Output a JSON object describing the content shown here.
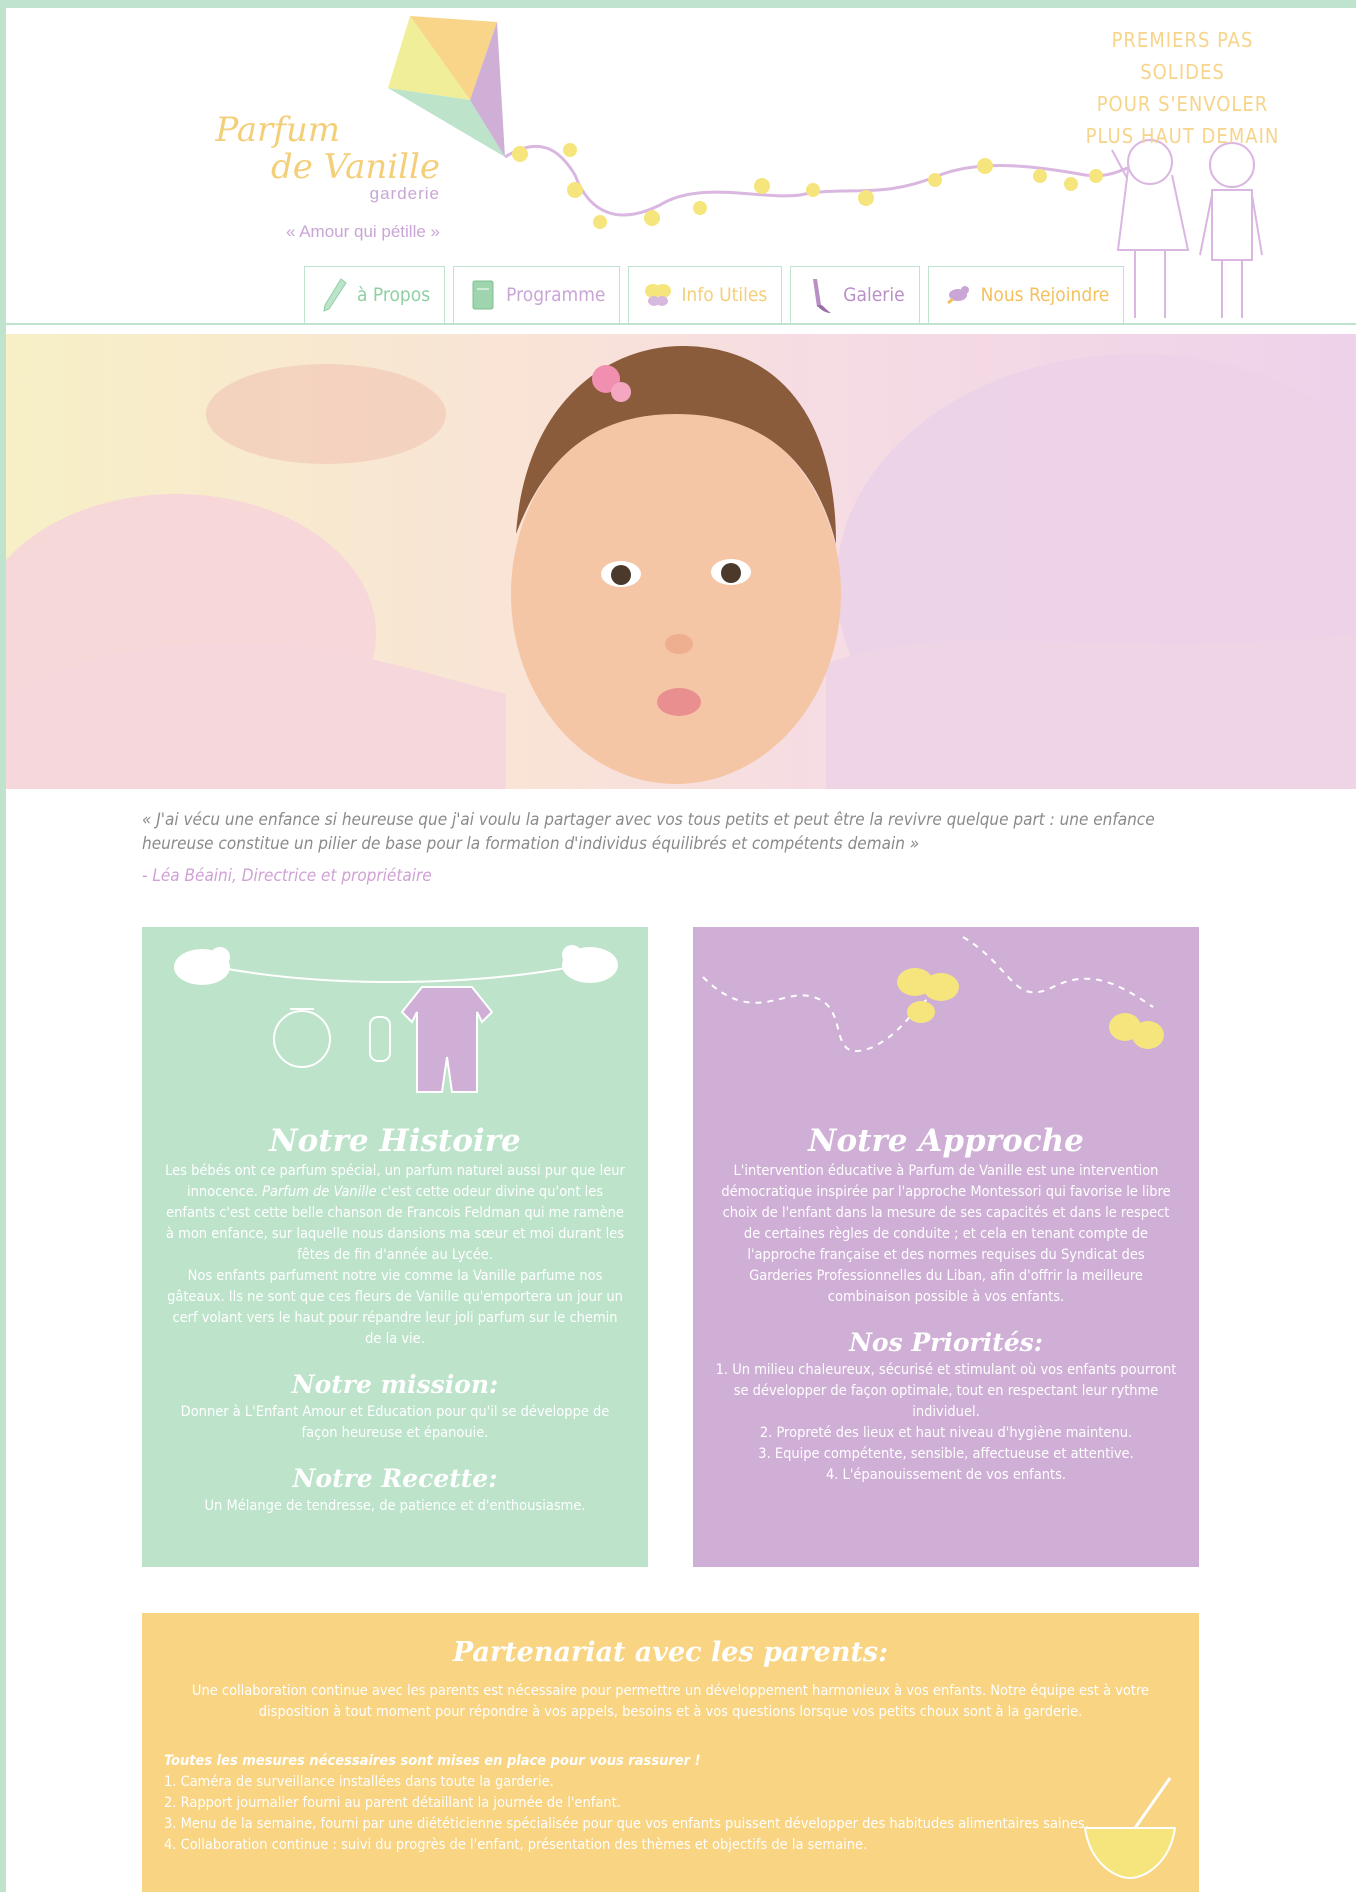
{
  "header": {
    "logo_line1": "Parfum",
    "logo_line2": "de Vanille",
    "logo_sub": "garderie",
    "motto": "« Amour qui pétille »",
    "tagline": [
      "PREMIERS PAS SOLIDES",
      "POUR S'ENVOLER",
      "PLUS HAUT DEMAIN"
    ]
  },
  "nav": {
    "items": [
      {
        "label": "à Propos",
        "icon": "pencil-icon",
        "color": "#8fcfa4"
      },
      {
        "label": "Programme",
        "icon": "notebook-icon",
        "color": "#c9a6d6"
      },
      {
        "label": "Info Utiles",
        "icon": "butterfly-icon",
        "color": "#f4cf7a"
      },
      {
        "label": "Galerie",
        "icon": "paintbrush-icon",
        "color": "#b98fc6"
      },
      {
        "label": "Nous Rejoindre",
        "icon": "bird-icon",
        "color": "#f4c15e"
      }
    ]
  },
  "quote": {
    "text": "«  J'ai vécu une enfance si heureuse que j'ai voulu la partager avec vos tous petits et peut être la revivre quelque part : une enfance heureuse constitue un pilier de base pour la formation d'individus équilibrés et compétents demain »",
    "author": "- Léa Béaini, Directrice et propriétaire"
  },
  "histoire": {
    "title": "Notre Histoire",
    "p1a": "Les bébés ont ce parfum spécial, un parfum naturel aussi pur que leur innocence. ",
    "p1em": "Parfum de Vanille",
    "p1b": " c'est cette odeur divine qu'ont les enfants c'est cette belle chanson de Francois Feldman qui me ramène à mon enfance, sur laquelle nous dansions ma sœur et moi durant les fêtes de fin d'année au Lycée.",
    "p2": "Nos enfants parfument notre vie comme la Vanille parfume nos gâteaux. Ils ne sont que ces fleurs de Vanille qu'emportera un jour un cerf volant vers le haut pour répandre leur joli parfum sur le chemin de la vie.",
    "mission_title": "Notre mission:",
    "mission": "Donner à L'Enfant Amour et Education pour qu'il se développe de façon heureuse et épanouie.",
    "recette_title": "Notre Recette:",
    "recette": "Un Mélange de tendresse, de patience et d'enthousiasme."
  },
  "approche": {
    "title": "Notre Approche",
    "text": "L'intervention éducative à Parfum de Vanille est une intervention démocratique inspirée par l'approche Montessori qui favorise le libre choix de l'enfant dans la mesure de ses capacités et dans le respect de certaines règles de conduite ; et cela en tenant compte de l'approche française et des normes requises du Syndicat des Garderies Professionnelles du Liban, afin d'offrir la meilleure combinaison possible à vos enfants.",
    "priorites_title": "Nos Priorités:",
    "priorites": [
      "1. Un milieu chaleureux, sécurisé et stimulant où vos enfants pourront se développer de façon optimale, tout en respectant leur rythme individuel.",
      "2. Propreté des lieux et haut niveau d'hygiène maintenu.",
      "3. Equipe compétente, sensible, affectueuse et attentive.",
      "4. L'épanouissement de vos enfants."
    ]
  },
  "partenariat": {
    "title": "Partenariat avec les parents:",
    "intro": "Une collaboration continue avec les parents est nécessaire pour permettre un développement harmonieux à vos enfants. Notre équipe est à votre disposition à tout moment pour répondre à vos appels, besoins et à vos questions lorsque vos petits  choux sont à la garderie.",
    "lead": "Toutes les mesures nécessaires sont mises en place pour vous rassurer !",
    "items": [
      "1. Caméra de surveillance installées dans toute la garderie.",
      "2. Rapport journalier fourni au parent détaillant la journée de l'enfant.",
      "3. Menu de la semaine, fourni par une diététicienne spécialisée pour que vos enfants puissent développer des habitudes alimentaires saines.",
      "4. Collaboration continue : suivi du progrès de l'enfant, présentation des thèmes et objectifs de la semaine."
    ]
  }
}
